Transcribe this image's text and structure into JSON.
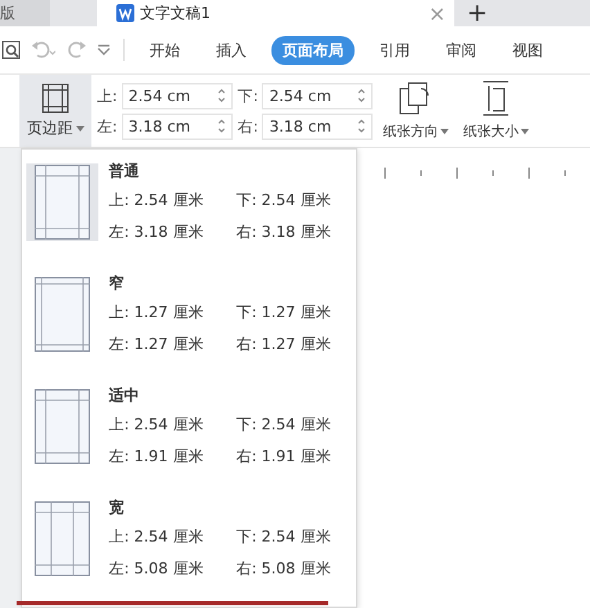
{
  "tabs": [
    {
      "label": "版",
      "selected": false
    },
    {
      "label": "文字文稿1",
      "selected": true
    }
  ],
  "close_glyph": "×",
  "new_tab_glyph": "+",
  "menu_tabs": [
    {
      "label": "开始",
      "selected": false
    },
    {
      "label": "插入",
      "selected": false
    },
    {
      "label": "页面布局",
      "selected": true
    },
    {
      "label": "引用",
      "selected": false
    },
    {
      "label": "审阅",
      "selected": false
    },
    {
      "label": "视图",
      "selected": false
    }
  ],
  "margins_button": {
    "label": "页边距",
    "expanded": true
  },
  "margin_fields": [
    {
      "label": "上:",
      "value": "2.54 cm"
    },
    {
      "label": "下:",
      "value": "2.54 cm"
    },
    {
      "label": "左:",
      "value": "3.18 cm"
    },
    {
      "label": "右:",
      "value": "3.18 cm"
    }
  ],
  "ribbon_buttons": [
    {
      "label": "纸张方向",
      "kind": "orientation"
    },
    {
      "label": "纸张大小",
      "kind": "size"
    }
  ],
  "presets": [
    {
      "name": "普通",
      "selected": true,
      "kind": "normal",
      "top": "上: 2.54 厘米",
      "bottom": "下: 2.54 厘米",
      "left": "左: 3.18 厘米",
      "right": "右: 3.18 厘米"
    },
    {
      "name": "窄",
      "selected": false,
      "kind": "narrow",
      "top": "上: 1.27 厘米",
      "bottom": "下: 1.27 厘米",
      "left": "左: 1.27 厘米",
      "right": "右: 1.27 厘米"
    },
    {
      "name": "适中",
      "selected": false,
      "kind": "normal",
      "top": "上: 2.54 厘米",
      "bottom": "下: 2.54 厘米",
      "left": "左: 1.91 厘米",
      "right": "右: 1.91 厘米"
    },
    {
      "name": "宽",
      "selected": false,
      "kind": "wide",
      "top": "上: 2.54 厘米",
      "bottom": "下: 2.54 厘米",
      "left": "左: 5.08 厘米",
      "right": "右: 5.08 厘米"
    }
  ]
}
